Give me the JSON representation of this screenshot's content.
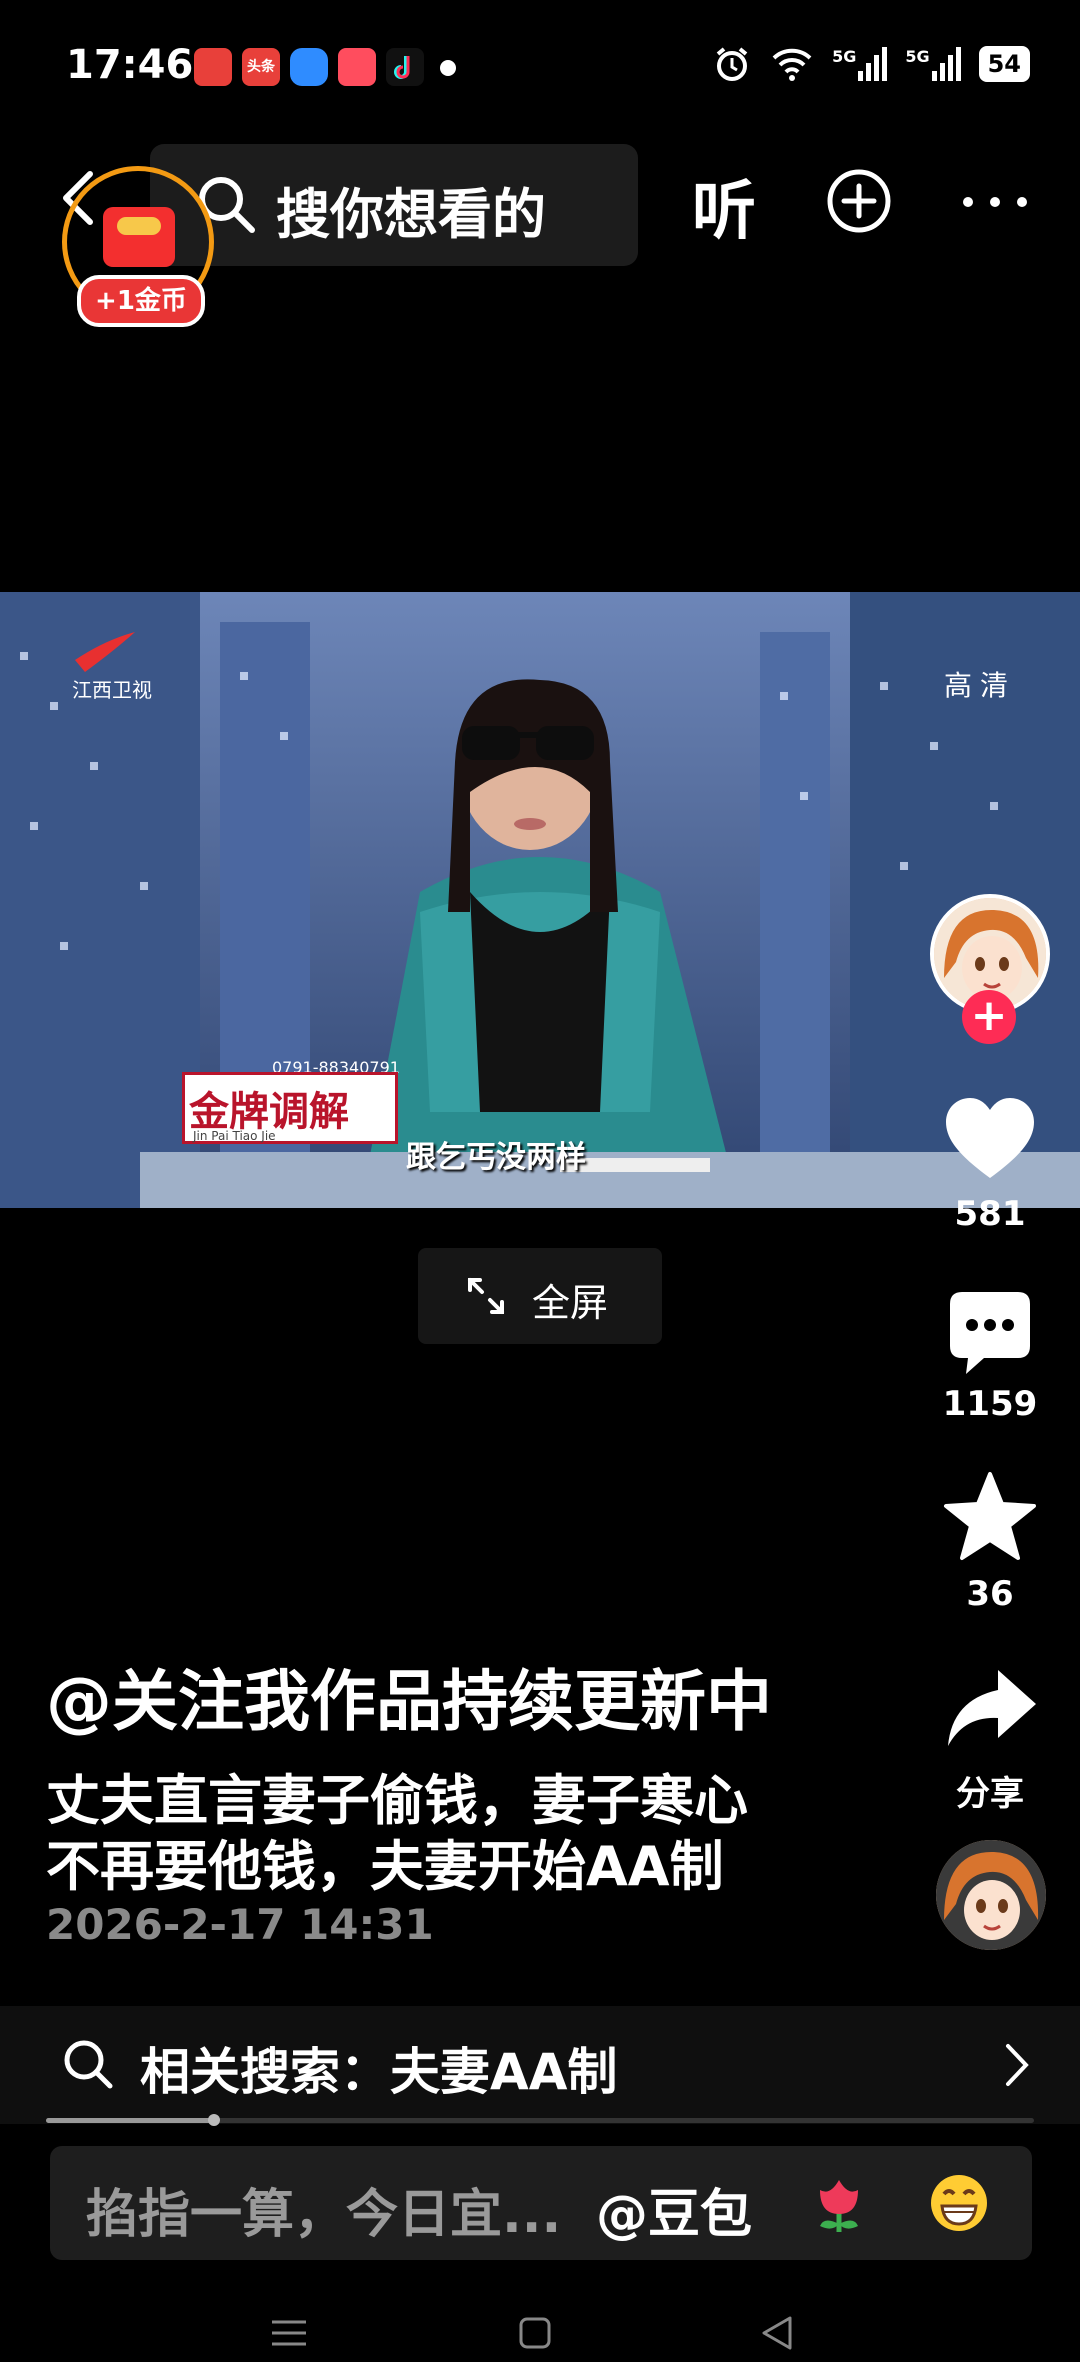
{
  "status_bar": {
    "time": "17:46",
    "app_icons": [
      {
        "name": "app-red-icon",
        "color": "#e8403a"
      },
      {
        "name": "toutiao-icon",
        "label": "头条",
        "color": "#e8403a"
      },
      {
        "name": "blue-app-icon",
        "color": "#2f8cff"
      },
      {
        "name": "video-app-icon",
        "color": "#ff4d5e"
      },
      {
        "name": "tiktok-icon",
        "color": "#111111"
      }
    ],
    "network_1": "5G",
    "network_2": "5G",
    "battery": "54"
  },
  "top_bar": {
    "search_placeholder": "搜你想看的",
    "listen_label": "听"
  },
  "red_packet": {
    "badge": "+1金币"
  },
  "video": {
    "channel": "江西卫视",
    "quality": "高清",
    "show_name": "金牌调解",
    "show_sub": "Jin Pai    Tiao Jie",
    "phone": "0791-88340791",
    "subtitle": "跟乞丐没两样"
  },
  "fullscreen": {
    "label": "全屏"
  },
  "rail": {
    "like_count": "581",
    "comment_count": "1159",
    "favorite_count": "36",
    "share_label": "分享"
  },
  "caption": {
    "author": "@关注我作品持续更新中",
    "line1": "丈夫直言妻子偷钱，妻子寒心",
    "line2": "不再要他钱，夫妻开始AA制",
    "date": "2026-2-17 14:31"
  },
  "related_search": {
    "label": "相关搜索：夫妻AA制"
  },
  "progress": {
    "fraction": 0.17
  },
  "comment_input": {
    "placeholder": "掐指一算，今日宜...",
    "mention": "@豆包"
  },
  "colors": {
    "accent_red": "#fe2c55",
    "coin_orange": "#f39a13"
  }
}
